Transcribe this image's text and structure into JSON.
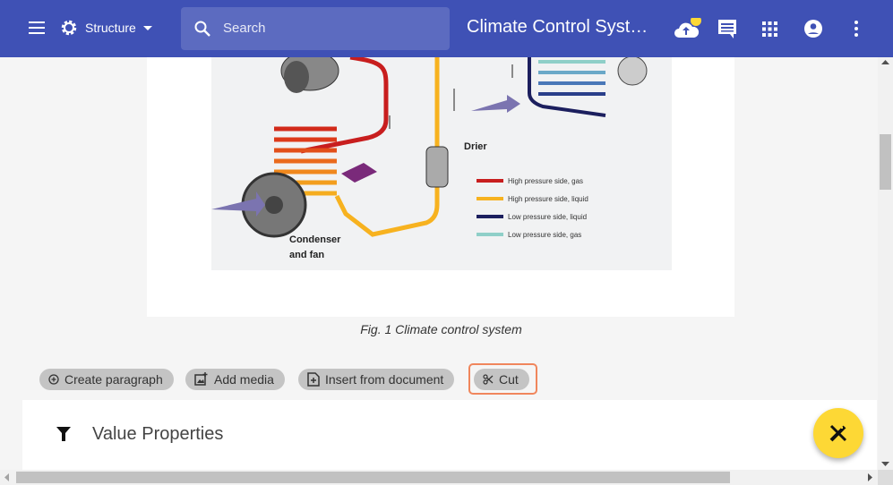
{
  "header": {
    "menu_icon": "menu-icon",
    "structure_label": "Structure",
    "search_placeholder": "Search",
    "title": "Climate Control Syst…"
  },
  "figure": {
    "caption": "Fig. 1 Climate control system",
    "labels": {
      "drier": "Drier",
      "condenser_line1": "Condenser",
      "condenser_line2": "and fan"
    },
    "legend": [
      {
        "label": "High pressure side, gas",
        "color": "#c81e1e"
      },
      {
        "label": "High pressure side, liquid",
        "color": "#f7b21f"
      },
      {
        "label": "Low pressure side, liquid",
        "color": "#1c1f5e"
      },
      {
        "label": "Low pressure side, gas",
        "color": "#8fcfc8"
      }
    ]
  },
  "actions": [
    {
      "label": "Create paragraph"
    },
    {
      "label": "Add media"
    },
    {
      "label": "Insert from document"
    },
    {
      "label": "Cut"
    }
  ],
  "section": {
    "title": "Value Properties"
  },
  "colors": {
    "primary": "#3f51b5",
    "accent": "#fdd835",
    "highlight": "#f0865c"
  }
}
